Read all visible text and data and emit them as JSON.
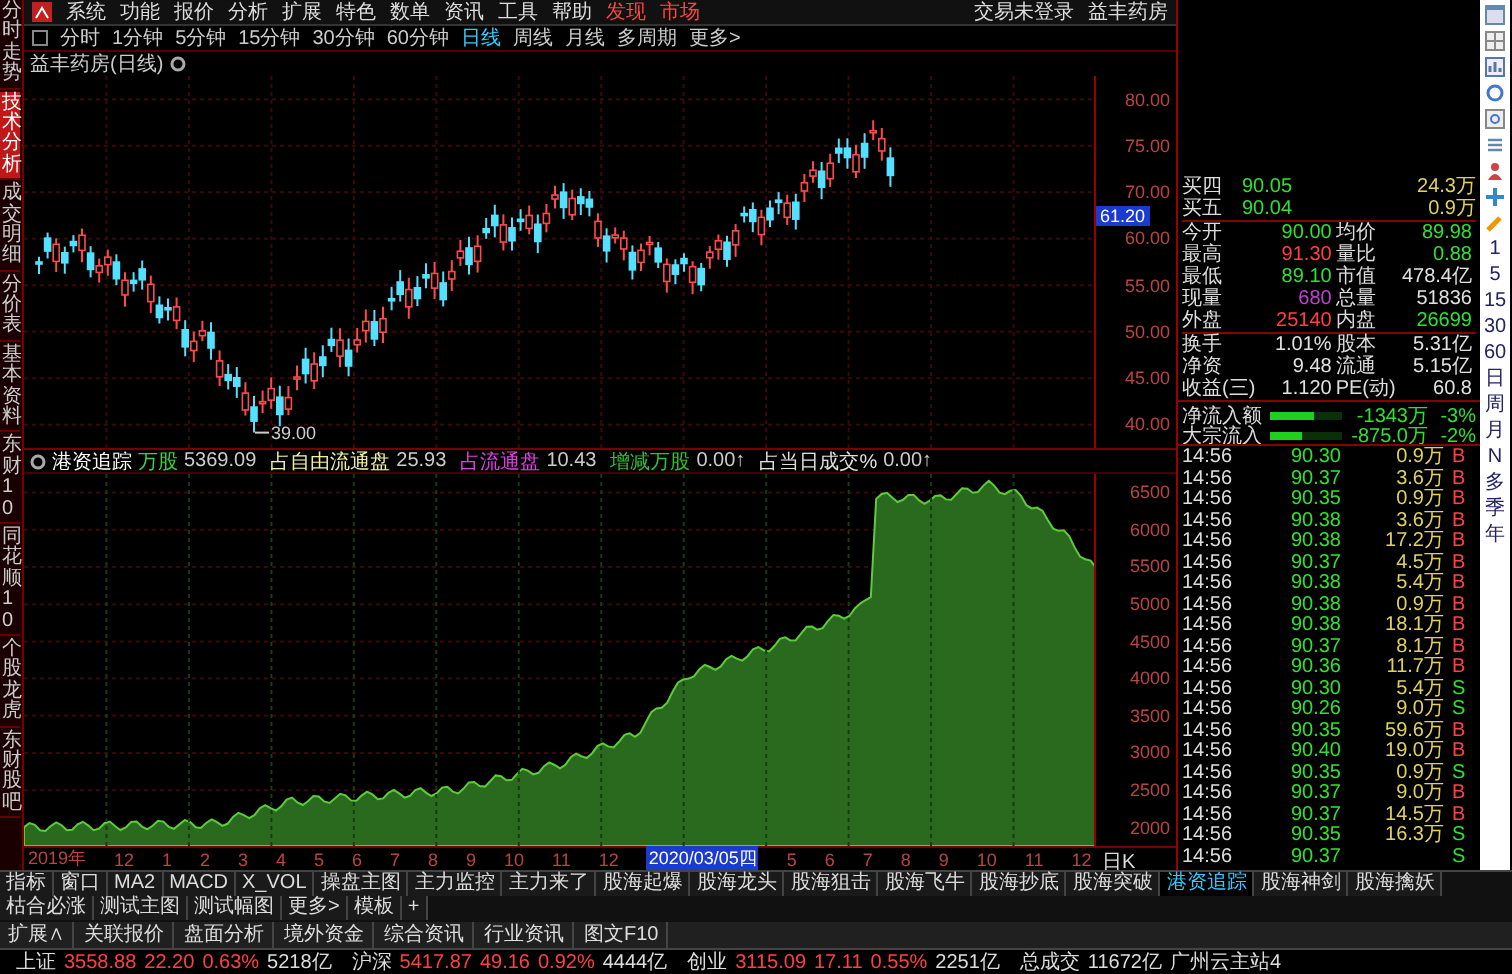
{
  "side_tabs": [
    {
      "label": "分时走势",
      "selected": false
    },
    {
      "label": "技术分析",
      "selected": true
    },
    {
      "label": "成交明细",
      "selected": false
    },
    {
      "label": "分价表",
      "selected": false
    },
    {
      "label": "基本资料",
      "selected": false
    },
    {
      "label": "东财10",
      "selected": false
    },
    {
      "label": "同花顺10",
      "selected": false
    },
    {
      "label": "个股龙虎",
      "selected": false
    },
    {
      "label": "东财股吧",
      "selected": false
    }
  ],
  "menu": [
    {
      "label": "系统",
      "kind": "normal"
    },
    {
      "label": "功能",
      "kind": "normal"
    },
    {
      "label": "报价",
      "kind": "normal"
    },
    {
      "label": "分析",
      "kind": "normal"
    },
    {
      "label": "扩展",
      "kind": "normal"
    },
    {
      "label": "特色",
      "kind": "normal"
    },
    {
      "label": "数单",
      "kind": "normal"
    },
    {
      "label": "资讯",
      "kind": "normal"
    },
    {
      "label": "工具",
      "kind": "normal"
    },
    {
      "label": "帮助",
      "kind": "normal"
    },
    {
      "label": "发现",
      "kind": "accent"
    },
    {
      "label": "市场",
      "kind": "accent"
    }
  ],
  "account": {
    "status": "交易未登录",
    "stock": "益丰药房"
  },
  "periods": [
    {
      "label": "分时",
      "selected": false
    },
    {
      "label": "1分钟",
      "selected": false
    },
    {
      "label": "5分钟",
      "selected": false
    },
    {
      "label": "15分钟",
      "selected": false
    },
    {
      "label": "30分钟",
      "selected": false
    },
    {
      "label": "60分钟",
      "selected": false
    },
    {
      "label": "日线",
      "selected": true
    },
    {
      "label": "周线",
      "selected": false
    },
    {
      "label": "月线",
      "selected": false
    },
    {
      "label": "多周期",
      "selected": false
    },
    {
      "label": "更多>",
      "selected": false
    }
  ],
  "chart_title": "益丰药房(日线)",
  "price_axis": {
    "labels": [
      "80.00",
      "75.00",
      "70.00",
      "60.00",
      "55.00",
      "50.00",
      "45.00",
      "40.00"
    ],
    "cursor": "61.20",
    "low_label": "39.00"
  },
  "indicator": {
    "name": "港资追踪",
    "items": [
      {
        "label": "万股",
        "value": "5369.09",
        "color": "#40d040"
      },
      {
        "label": "占自由流通盘",
        "value": "25.93",
        "color": "#f0f0a0"
      },
      {
        "label": "占流通盘",
        "value": "10.43",
        "color": "#e040e0"
      },
      {
        "label": "增减万股",
        "value": "0.00↑",
        "color": "#30c030"
      },
      {
        "label": "占当日成交%",
        "value": "0.00↑",
        "color": "#e0e0e0"
      }
    ]
  },
  "volume_axis": {
    "labels": [
      "6500",
      "6000",
      "5500",
      "5000",
      "4500",
      "4000",
      "3500",
      "3000",
      "2500",
      "2000"
    ]
  },
  "x_axis": {
    "labels": [
      {
        "label": "2019年",
        "selected": false
      },
      {
        "label": "12",
        "selected": false
      },
      {
        "label": "1",
        "selected": false
      },
      {
        "label": "2",
        "selected": false
      },
      {
        "label": "3",
        "selected": false
      },
      {
        "label": "4",
        "selected": false
      },
      {
        "label": "5",
        "selected": false
      },
      {
        "label": "6",
        "selected": false
      },
      {
        "label": "7",
        "selected": false
      },
      {
        "label": "8",
        "selected": false
      },
      {
        "label": "9",
        "selected": false
      },
      {
        "label": "10",
        "selected": false
      },
      {
        "label": "11",
        "selected": false
      },
      {
        "label": "12",
        "selected": false
      },
      {
        "label": "2020/03/05四",
        "selected": true
      },
      {
        "label": "5",
        "selected": false
      },
      {
        "label": "6",
        "selected": false
      },
      {
        "label": "7",
        "selected": false
      },
      {
        "label": "8",
        "selected": false
      },
      {
        "label": "9",
        "selected": false
      },
      {
        "label": "10",
        "selected": false
      },
      {
        "label": "11",
        "selected": false
      },
      {
        "label": "12",
        "selected": false
      }
    ],
    "unit": "日K"
  },
  "order_book": [
    {
      "label": "买四",
      "price": "90.05",
      "volume": "24.3万"
    },
    {
      "label": "买五",
      "price": "90.04",
      "volume": "0.9万"
    }
  ],
  "quote_stats": [
    {
      "label": "今开",
      "value": "90.00",
      "color": "#30e030"
    },
    {
      "label": "均价",
      "value": "89.98",
      "color": "#30e030"
    },
    {
      "label": "最高",
      "value": "91.30",
      "color": "#ff4040"
    },
    {
      "label": "量比",
      "value": "0.88",
      "color": "#30e030"
    },
    {
      "label": "最低",
      "value": "89.10",
      "color": "#30e030"
    },
    {
      "label": "市值",
      "value": "478.4亿",
      "color": "#e0e0e0"
    },
    {
      "label": "现量",
      "value": "680",
      "color": "#c040d0"
    },
    {
      "label": "总量",
      "value": "51836",
      "color": "#e0e0e0"
    },
    {
      "label": "外盘",
      "value": "25140",
      "color": "#ff4040"
    },
    {
      "label": "内盘",
      "value": "26699",
      "color": "#30e030"
    },
    {
      "label": "换手",
      "value": "1.01%",
      "color": "#e0e0e0"
    },
    {
      "label": "股本",
      "value": "5.31亿",
      "color": "#e0e0e0"
    },
    {
      "label": "净资",
      "value": "9.48",
      "color": "#e0e0e0"
    },
    {
      "label": "流通",
      "value": "5.15亿",
      "color": "#e0e0e0"
    },
    {
      "label": "收益(三)",
      "value": "1.120",
      "color": "#e0e0e0"
    },
    {
      "label": "PE(动)",
      "value": "60.8",
      "color": "#e0e0e0"
    }
  ],
  "fund_flow": [
    {
      "label": "净流入额",
      "level": 0.6,
      "amount": "-1343万",
      "percent": "-3%"
    },
    {
      "label": "大宗流入",
      "level": 0.45,
      "amount": "-875.0万",
      "percent": "-2%"
    }
  ],
  "trades": [
    {
      "time": "14:56",
      "price": "90.30",
      "volume": "0.9万",
      "side": "B",
      "kind": "buy"
    },
    {
      "time": "14:56",
      "price": "90.37",
      "volume": "3.6万",
      "side": "B",
      "kind": "buy"
    },
    {
      "time": "14:56",
      "price": "90.35",
      "volume": "0.9万",
      "side": "B",
      "kind": "buy"
    },
    {
      "time": "14:56",
      "price": "90.38",
      "volume": "3.6万",
      "side": "B",
      "kind": "buy"
    },
    {
      "time": "14:56",
      "price": "90.38",
      "volume": "17.2万",
      "side": "B",
      "kind": "buy"
    },
    {
      "time": "14:56",
      "price": "90.37",
      "volume": "4.5万",
      "side": "B",
      "kind": "buy"
    },
    {
      "time": "14:56",
      "price": "90.38",
      "volume": "5.4万",
      "side": "B",
      "kind": "buy"
    },
    {
      "time": "14:56",
      "price": "90.38",
      "volume": "0.9万",
      "side": "B",
      "kind": "buy"
    },
    {
      "time": "14:56",
      "price": "90.38",
      "volume": "18.1万",
      "side": "B",
      "kind": "buy"
    },
    {
      "time": "14:56",
      "price": "90.37",
      "volume": "8.1万",
      "side": "B",
      "kind": "buy"
    },
    {
      "time": "14:56",
      "price": "90.36",
      "volume": "11.7万",
      "side": "B",
      "kind": "buy"
    },
    {
      "time": "14:56",
      "price": "90.30",
      "volume": "5.4万",
      "side": "S",
      "kind": "sell"
    },
    {
      "time": "14:56",
      "price": "90.26",
      "volume": "9.0万",
      "side": "S",
      "kind": "sell"
    },
    {
      "time": "14:56",
      "price": "90.35",
      "volume": "59.6万",
      "side": "B",
      "kind": "buy"
    },
    {
      "time": "14:56",
      "price": "90.40",
      "volume": "19.0万",
      "side": "B",
      "kind": "buy"
    },
    {
      "time": "14:56",
      "price": "90.35",
      "volume": "0.9万",
      "side": "S",
      "kind": "sell"
    },
    {
      "time": "14:56",
      "price": "90.37",
      "volume": "9.0万",
      "side": "B",
      "kind": "buy"
    },
    {
      "time": "14:56",
      "price": "90.37",
      "volume": "14.5万",
      "side": "B",
      "kind": "buy"
    },
    {
      "time": "14:56",
      "price": "90.35",
      "volume": "16.3万",
      "side": "S",
      "kind": "sell"
    },
    {
      "time": "14:56",
      "price": "90.37",
      "side": "S",
      "kind": "sell"
    }
  ],
  "toolbar_periods": [
    "1",
    "5",
    "15",
    "30",
    "60",
    "日",
    "周",
    "月",
    "N",
    "多",
    "季",
    "年"
  ],
  "indicator_tabs": [
    {
      "label": "指标",
      "selected": false
    },
    {
      "label": "窗口",
      "selected": false
    },
    {
      "label": "MA2",
      "selected": false
    },
    {
      "label": "MACD",
      "selected": false
    },
    {
      "label": "X_VOL",
      "selected": false
    },
    {
      "label": "操盘主图",
      "selected": false
    },
    {
      "label": "主力监控",
      "selected": false
    },
    {
      "label": "主力来了",
      "selected": false
    },
    {
      "label": "股海起爆",
      "selected": false
    },
    {
      "label": "股海龙头",
      "selected": false
    },
    {
      "label": "股海狙击",
      "selected": false
    },
    {
      "label": "股海飞牛",
      "selected": false
    },
    {
      "label": "股海抄底",
      "selected": false
    },
    {
      "label": "股海突破",
      "selected": false
    },
    {
      "label": "港资追踪",
      "selected": true
    },
    {
      "label": "股海神剑",
      "selected": false
    },
    {
      "label": "股海擒妖",
      "selected": false
    },
    {
      "label": "枯合必涨",
      "selected": false
    },
    {
      "label": "测试主图",
      "selected": false
    },
    {
      "label": "测试幅图",
      "selected": false
    },
    {
      "label": "更多>",
      "selected": false
    },
    {
      "label": "模板",
      "selected": false
    },
    {
      "label": "+",
      "selected": false
    }
  ],
  "info_tabs": [
    "扩展∧",
    "关联报价",
    "盘面分析",
    "境外资金",
    "综合资讯",
    "行业资讯",
    "图文F10"
  ],
  "status_bar": [
    {
      "label": "上证",
      "value": "3558.88",
      "change": "22.20",
      "percent": "0.63%",
      "amount": "5218亿",
      "color": "#ff4040"
    },
    {
      "label": "沪深",
      "value": "5417.87",
      "change": "49.16",
      "percent": "0.92%",
      "amount": "4444亿",
      "color": "#ff4040"
    },
    {
      "label": "创业",
      "value": "3115.09",
      "change": "17.11",
      "percent": "0.55%",
      "amount": "2251亿",
      "color": "#ff4040"
    }
  ],
  "total": {
    "label": "总成交",
    "amount": "11672亿",
    "server": "广州云主站4"
  }
}
